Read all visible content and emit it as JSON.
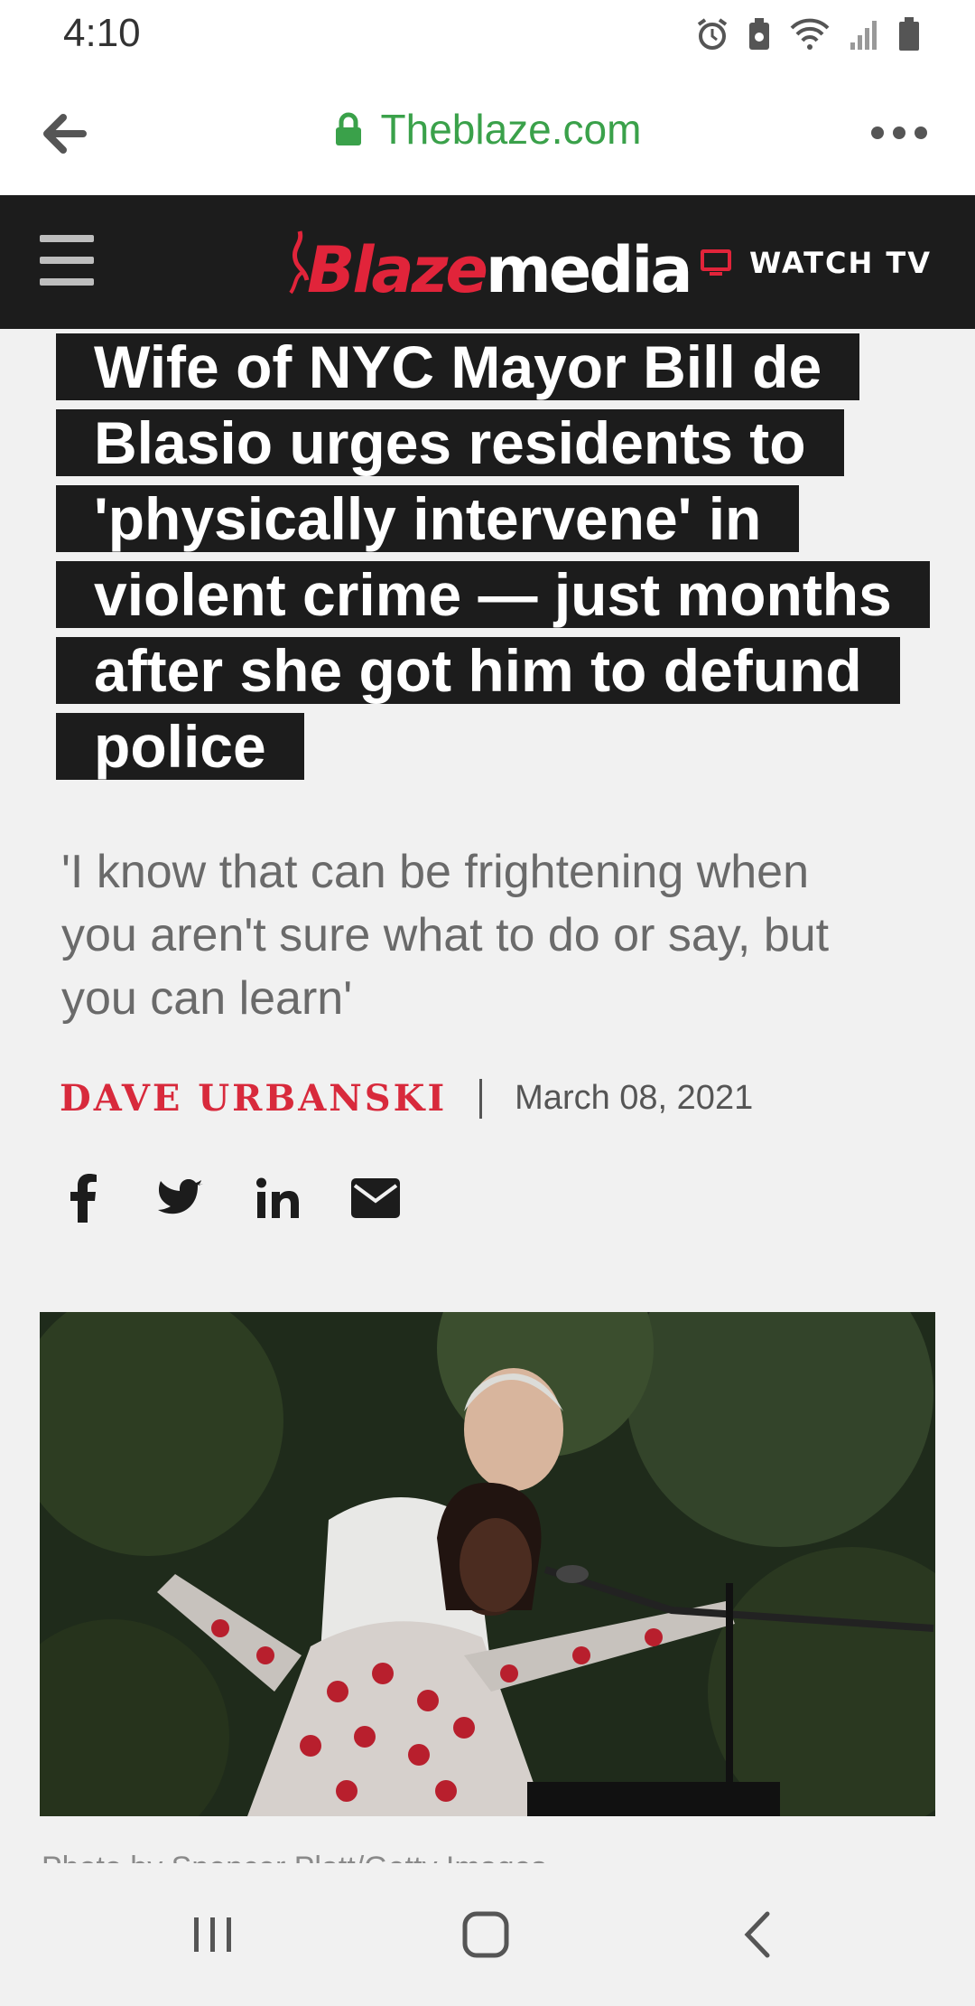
{
  "status_bar": {
    "time": "4:10",
    "icons": [
      "alarm-icon",
      "battery-saver-icon",
      "wifi-icon",
      "signal-icon",
      "battery-icon"
    ]
  },
  "browser": {
    "url": "Theblaze.com",
    "url_color": "#3aa14a"
  },
  "site_header": {
    "logo_part1": "Blaze",
    "logo_part2": "media",
    "watch_tv_label": "WATCH TV",
    "brand_red": "#e1243a",
    "header_bg": "#1c1c1c"
  },
  "article": {
    "headline": "Wife of NYC Mayor Bill de Blasio urges residents to 'physically intervene' in violent crime — just months after she got him to defund police",
    "subtitle": "'I know that can be frightening when you aren't sure what to do or say, but you can learn'",
    "author": "DAVE URBANSKI",
    "date": "March 08, 2021",
    "share_icons": [
      "facebook-icon",
      "twitter-icon",
      "linkedin-icon",
      "email-icon"
    ],
    "photo_credit": "Photo by Spencer Platt/Getty Images"
  },
  "nav_bar": {
    "icons": [
      "recents-icon",
      "home-icon",
      "back-icon"
    ]
  }
}
